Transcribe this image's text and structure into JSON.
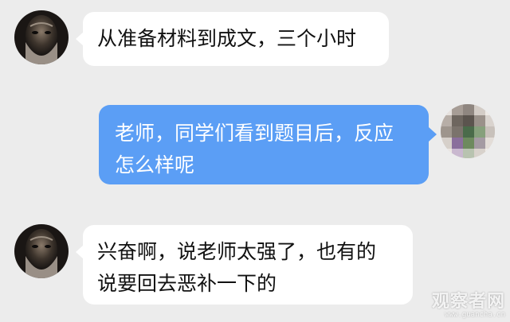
{
  "chat": {
    "messages": [
      {
        "sender": "other",
        "lines": [
          "从准备材料到成文，三个小时"
        ]
      },
      {
        "sender": "self",
        "lines": [
          "老师，同学们看到题目后，反应",
          "怎么样呢"
        ]
      },
      {
        "sender": "other",
        "lines": [
          "兴奋啊，说老师太强了，也有的",
          "说要回去恶补一下的"
        ]
      }
    ],
    "colors": {
      "background": "#ececec",
      "incoming_bubble": "#ffffff",
      "outgoing_bubble": "#5b9ef5"
    }
  },
  "watermark": {
    "main": "观察者网",
    "sub": "www.guancha.cn"
  }
}
